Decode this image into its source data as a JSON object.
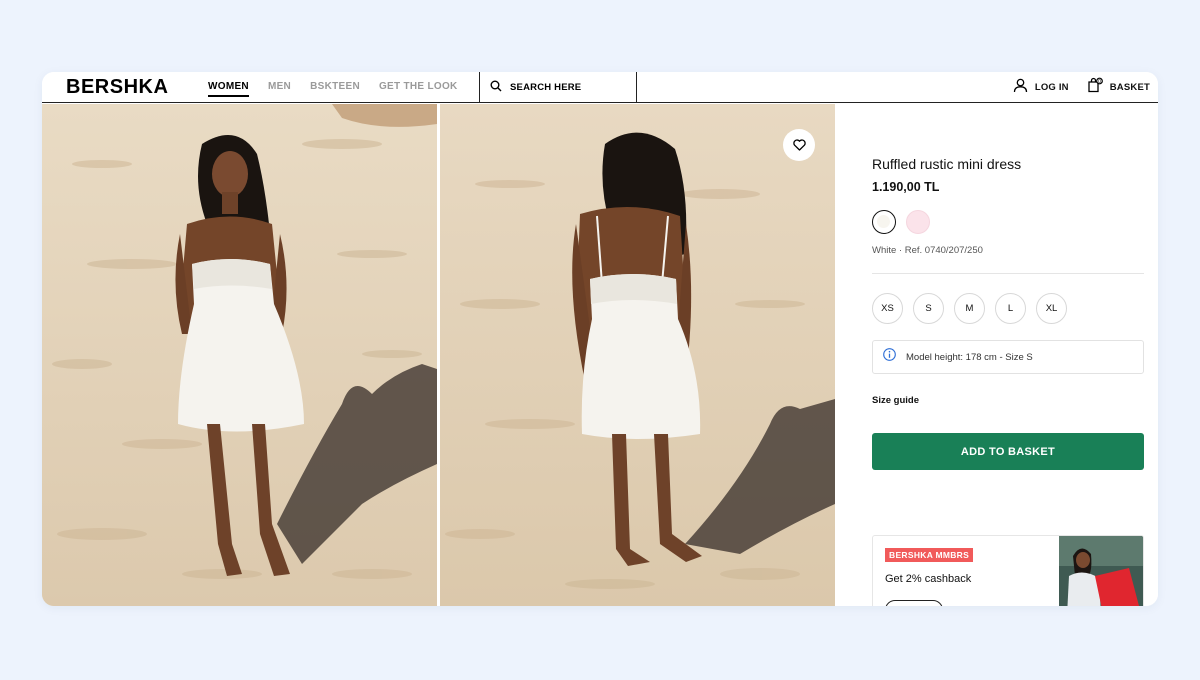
{
  "brand": {
    "logo": "BERSHKA"
  },
  "nav": {
    "items": [
      {
        "label": "WOMEN",
        "active": true
      },
      {
        "label": "MEN",
        "active": false
      },
      {
        "label": "BSKTEEN",
        "active": false
      },
      {
        "label": "GET THE LOOK",
        "active": false
      }
    ]
  },
  "search": {
    "label": "SEARCH HERE"
  },
  "header_actions": {
    "login": "LOG IN",
    "basket": "BASKET"
  },
  "product": {
    "title": "Ruffled rustic mini dress",
    "price": "1.190,00 TL",
    "colors": [
      {
        "name": "White",
        "hex": "#f7f5ef",
        "selected": true
      },
      {
        "name": "Pink",
        "hex": "#fbe3ea",
        "selected": false
      }
    ],
    "color_ref": "White · Ref. 0740/207/250",
    "sizes": [
      "XS",
      "S",
      "M",
      "L",
      "XL"
    ],
    "model_info": "Model height: 178 cm - Size S",
    "size_guide": "Size guide",
    "add_to_basket": "ADD TO BASKET"
  },
  "promo": {
    "badge": "BERSHKA MMBRS",
    "text": "Get 2% cashback"
  },
  "colors": {
    "accent_green": "#198057",
    "promo_red": "#f15a5a",
    "page_bg": "#edf3fd",
    "sand": "#e6d6bd"
  },
  "icons": {
    "search": "search-icon",
    "login": "user-icon",
    "basket": "basket-icon",
    "favorite": "heart-icon",
    "info": "info-icon"
  }
}
